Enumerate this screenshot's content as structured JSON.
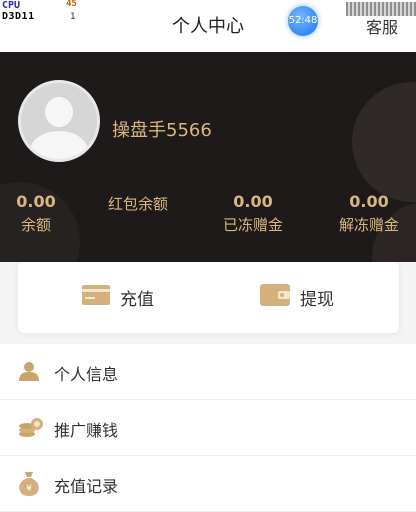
{
  "status_overlay": {
    "cpu_label": "CPU",
    "cpu_value": "D3D11",
    "fps_value": "45",
    "fps_sub": "1"
  },
  "header": {
    "title": "个人中心",
    "clock_badge": "52:48",
    "service_label": "客服"
  },
  "profile": {
    "username": "操盘手5566"
  },
  "stats": [
    {
      "value": "0.00",
      "label": "余额"
    },
    {
      "value": "",
      "label": "红包余额"
    },
    {
      "value": "0.00",
      "label": "已冻赠金"
    },
    {
      "value": "0.00",
      "label": "解冻赠金"
    }
  ],
  "actions": {
    "recharge_label": "充值",
    "withdraw_label": "提现"
  },
  "menu": {
    "items": [
      {
        "label": "个人信息",
        "icon": "person-icon"
      },
      {
        "label": "推广赚钱",
        "icon": "coins-icon"
      },
      {
        "label": "充值记录",
        "icon": "money-bag-icon"
      }
    ]
  },
  "colors": {
    "gold": "#d8b683",
    "hero_bg": "#1d1a19"
  }
}
